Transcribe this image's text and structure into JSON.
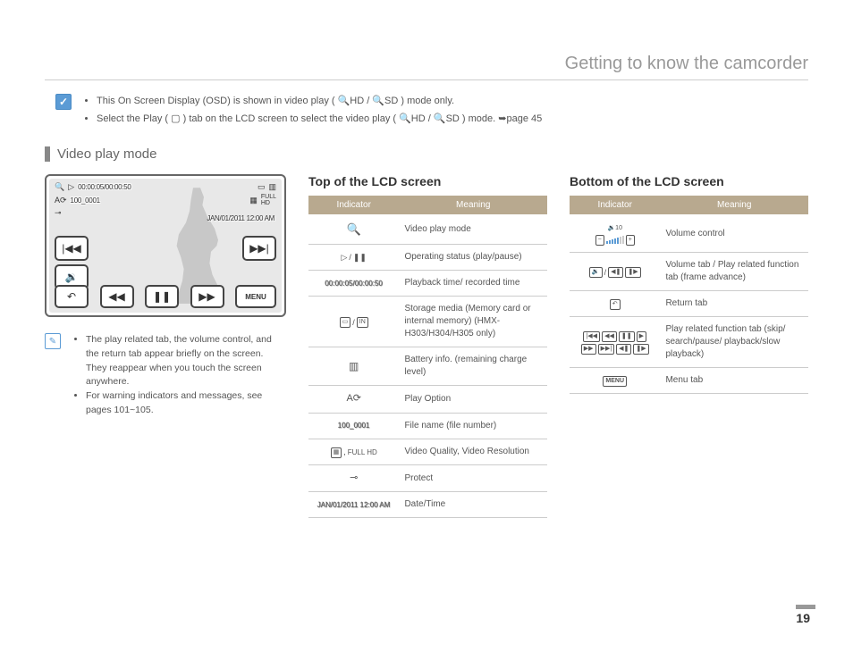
{
  "chapter_title": "Getting to know the camcorder",
  "top_notes": [
    "This On Screen Display (OSD) is shown in video play ( 🔍HD / 🔍SD ) mode only.",
    "Select the Play ( ▢ ) tab on the LCD screen to select the video play ( 🔍HD / 🔍SD ) mode. ➥page 45"
  ],
  "section_heading": "Video play mode",
  "lcd": {
    "time": "00:00:05/00:00:50",
    "filename": "100_0001",
    "datetime": "JAN/01/2011 12:00 AM",
    "menu_label": "MENU"
  },
  "left_notes": [
    "The play related tab, the volume control, and the return tab appear briefly on the screen.\nThey reappear when you touch the screen anywhere.",
    "For warning indicators and messages, see pages 101~105."
  ],
  "top_table": {
    "heading": "Top of the LCD screen",
    "headers": [
      "Indicator",
      "Meaning"
    ],
    "rows": [
      {
        "ind_label": "video-play-mode-icon",
        "meaning": "Video play mode"
      },
      {
        "ind_label": "play-pause-icons",
        "meaning": "Operating status (play/pause)"
      },
      {
        "ind_text": "00:00:05/00:00:50",
        "meaning": "Playback time/ recorded time"
      },
      {
        "ind_label": "storage-media-icons",
        "meaning": "Storage media (Memory card or internal memory) (HMX-H303/H304/H305 only)"
      },
      {
        "ind_label": "battery-icon",
        "meaning": "Battery info. (remaining charge level)"
      },
      {
        "ind_label": "play-option-icon",
        "meaning": "Play Option"
      },
      {
        "ind_text": "100_0001",
        "meaning": "File name (file number)"
      },
      {
        "ind_label": "quality-resolution-icons",
        "meaning": "Video Quality, Video Resolution"
      },
      {
        "ind_label": "protect-icon",
        "meaning": "Protect"
      },
      {
        "ind_text": "JAN/01/2011 12:00 AM",
        "meaning": "Date/Time"
      }
    ]
  },
  "bottom_table": {
    "heading": "Bottom of the LCD screen",
    "headers": [
      "Indicator",
      "Meaning"
    ],
    "rows": [
      {
        "ind_label": "volume-control-icons",
        "meaning": "Volume control"
      },
      {
        "ind_label": "volume-tab-icons",
        "meaning": "Volume tab / Play related function tab (frame advance)"
      },
      {
        "ind_label": "return-tab-icon",
        "meaning": "Return tab"
      },
      {
        "ind_label": "play-function-tabs",
        "meaning": "Play related function tab (skip/ search/pause/ playback/slow playback)"
      },
      {
        "ind_label": "menu-tab-icon",
        "ind_text": "MENU",
        "meaning": "Menu tab"
      }
    ]
  },
  "page_number": "19"
}
